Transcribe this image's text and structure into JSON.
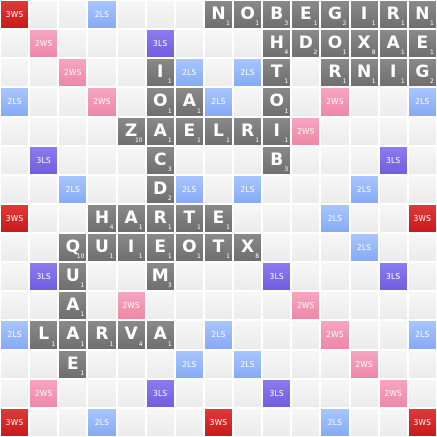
{
  "board": {
    "size": 15,
    "premium_rows": [
      [
        "3WS",
        "",
        "",
        "2LS",
        "",
        "",
        "",
        "",
        "",
        "",
        "",
        "",
        "",
        "",
        "3WS"
      ],
      [
        "",
        "2WS",
        "",
        "",
        "",
        "3LS",
        "",
        "",
        "",
        "",
        "",
        "",
        "",
        "",
        ""
      ],
      [
        "",
        "",
        "2WS",
        "",
        "",
        "",
        "2LS",
        "",
        "2LS",
        "",
        "",
        "",
        "",
        "",
        ""
      ],
      [
        "2LS",
        "",
        "",
        "2WS",
        "",
        "",
        "",
        "2LS",
        "",
        "",
        "",
        "2WS",
        "",
        "",
        "2LS"
      ],
      [
        "",
        "",
        "",
        "",
        "",
        "",
        "",
        "",
        "",
        "",
        "2WS",
        "",
        "",
        "",
        ""
      ],
      [
        "",
        "3LS",
        "",
        "",
        "",
        "",
        "",
        "",
        "",
        "",
        "",
        "",
        "",
        "3LS",
        ""
      ],
      [
        "",
        "",
        "2LS",
        "",
        "",
        "",
        "2LS",
        "",
        "2LS",
        "",
        "",
        "",
        "2LS",
        "",
        ""
      ],
      [
        "3WS",
        "",
        "",
        "2LS",
        "",
        "",
        "",
        "",
        "",
        "",
        "",
        "2LS",
        "",
        "",
        "3WS"
      ],
      [
        "",
        "",
        "",
        "",
        "",
        "",
        "",
        "",
        "",
        "",
        "",
        "",
        "2LS",
        "",
        ""
      ],
      [
        "",
        "3LS",
        "",
        "",
        "",
        "",
        "",
        "",
        "",
        "3LS",
        "",
        "",
        "",
        "3LS",
        ""
      ],
      [
        "",
        "",
        "",
        "",
        "2WS",
        "",
        "",
        "",
        "",
        "",
        "2WS",
        "",
        "",
        "",
        ""
      ],
      [
        "2LS",
        "",
        "",
        "",
        "",
        "",
        "",
        "2LS",
        "",
        "",
        "",
        "2WS",
        "",
        "",
        "2LS"
      ],
      [
        "",
        "",
        "",
        "",
        "",
        "",
        "2LS",
        "",
        "2LS",
        "",
        "",
        "",
        "2WS",
        "",
        ""
      ],
      [
        "",
        "2WS",
        "",
        "",
        "",
        "3LS",
        "",
        "",
        "",
        "3LS",
        "",
        "",
        "",
        "2WS",
        ""
      ],
      [
        "3WS",
        "",
        "",
        "2LS",
        "",
        "",
        "",
        "3WS",
        "",
        "",
        "",
        "2LS",
        "",
        "",
        "3WS"
      ]
    ],
    "tiles": [
      {
        "r": 0,
        "c": 7,
        "letter": "N",
        "points": "1"
      },
      {
        "r": 0,
        "c": 8,
        "letter": "O",
        "points": "1"
      },
      {
        "r": 0,
        "c": 9,
        "letter": "B",
        "points": "3"
      },
      {
        "r": 0,
        "c": 10,
        "letter": "E",
        "points": "1"
      },
      {
        "r": 0,
        "c": 11,
        "letter": "G",
        "points": "2"
      },
      {
        "r": 0,
        "c": 12,
        "letter": "I",
        "points": "1"
      },
      {
        "r": 0,
        "c": 13,
        "letter": "R",
        "points": "1"
      },
      {
        "r": 0,
        "c": 14,
        "letter": "N",
        "points": "1"
      },
      {
        "r": 1,
        "c": 9,
        "letter": "H",
        "points": "4"
      },
      {
        "r": 1,
        "c": 10,
        "letter": "D",
        "points": "2"
      },
      {
        "r": 1,
        "c": 11,
        "letter": "O",
        "points": "1"
      },
      {
        "r": 1,
        "c": 12,
        "letter": "X",
        "points": "8"
      },
      {
        "r": 1,
        "c": 13,
        "letter": "A",
        "points": "1"
      },
      {
        "r": 1,
        "c": 14,
        "letter": "E",
        "points": "1"
      },
      {
        "r": 2,
        "c": 5,
        "letter": "I",
        "points": "1"
      },
      {
        "r": 2,
        "c": 9,
        "letter": "T",
        "points": "1"
      },
      {
        "r": 2,
        "c": 11,
        "letter": "R",
        "points": "1"
      },
      {
        "r": 2,
        "c": 12,
        "letter": "N",
        "points": "1"
      },
      {
        "r": 2,
        "c": 13,
        "letter": "I",
        "points": "1"
      },
      {
        "r": 2,
        "c": 14,
        "letter": "G",
        "points": "2"
      },
      {
        "r": 3,
        "c": 5,
        "letter": "O",
        "points": "1"
      },
      {
        "r": 3,
        "c": 6,
        "letter": "A",
        "points": "1"
      },
      {
        "r": 3,
        "c": 9,
        "letter": "O",
        "points": "1"
      },
      {
        "r": 4,
        "c": 4,
        "letter": "Z",
        "points": "10"
      },
      {
        "r": 4,
        "c": 5,
        "letter": "A",
        "points": "1"
      },
      {
        "r": 4,
        "c": 6,
        "letter": "E",
        "points": "1"
      },
      {
        "r": 4,
        "c": 7,
        "letter": "L",
        "points": "1"
      },
      {
        "r": 4,
        "c": 8,
        "letter": "R",
        "points": "1"
      },
      {
        "r": 4,
        "c": 9,
        "letter": "I",
        "points": "1"
      },
      {
        "r": 5,
        "c": 5,
        "letter": "C",
        "points": "3"
      },
      {
        "r": 5,
        "c": 9,
        "letter": "B",
        "points": "3"
      },
      {
        "r": 6,
        "c": 5,
        "letter": "D",
        "points": "2"
      },
      {
        "r": 7,
        "c": 3,
        "letter": "H",
        "points": "4"
      },
      {
        "r": 7,
        "c": 4,
        "letter": "A",
        "points": "1"
      },
      {
        "r": 7,
        "c": 5,
        "letter": "R",
        "points": "1"
      },
      {
        "r": 7,
        "c": 6,
        "letter": "T",
        "points": "1"
      },
      {
        "r": 7,
        "c": 7,
        "letter": "E",
        "points": "1"
      },
      {
        "r": 8,
        "c": 2,
        "letter": "Q",
        "points": "10"
      },
      {
        "r": 8,
        "c": 3,
        "letter": "U",
        "points": "1"
      },
      {
        "r": 8,
        "c": 4,
        "letter": "I",
        "points": "1"
      },
      {
        "r": 8,
        "c": 5,
        "letter": "E",
        "points": "1"
      },
      {
        "r": 8,
        "c": 6,
        "letter": "O",
        "points": "1"
      },
      {
        "r": 8,
        "c": 7,
        "letter": "T",
        "points": "1"
      },
      {
        "r": 8,
        "c": 8,
        "letter": "X",
        "points": "8"
      },
      {
        "r": 9,
        "c": 2,
        "letter": "U",
        "points": "1"
      },
      {
        "r": 9,
        "c": 5,
        "letter": "M",
        "points": "3"
      },
      {
        "r": 10,
        "c": 2,
        "letter": "A",
        "points": "1"
      },
      {
        "r": 11,
        "c": 1,
        "letter": "L",
        "points": "1"
      },
      {
        "r": 11,
        "c": 2,
        "letter": "A",
        "points": "1"
      },
      {
        "r": 11,
        "c": 3,
        "letter": "R",
        "points": "1"
      },
      {
        "r": 11,
        "c": 4,
        "letter": "V",
        "points": "4"
      },
      {
        "r": 11,
        "c": 5,
        "letter": "A",
        "points": "1"
      },
      {
        "r": 12,
        "c": 2,
        "letter": "E",
        "points": "1"
      }
    ]
  }
}
